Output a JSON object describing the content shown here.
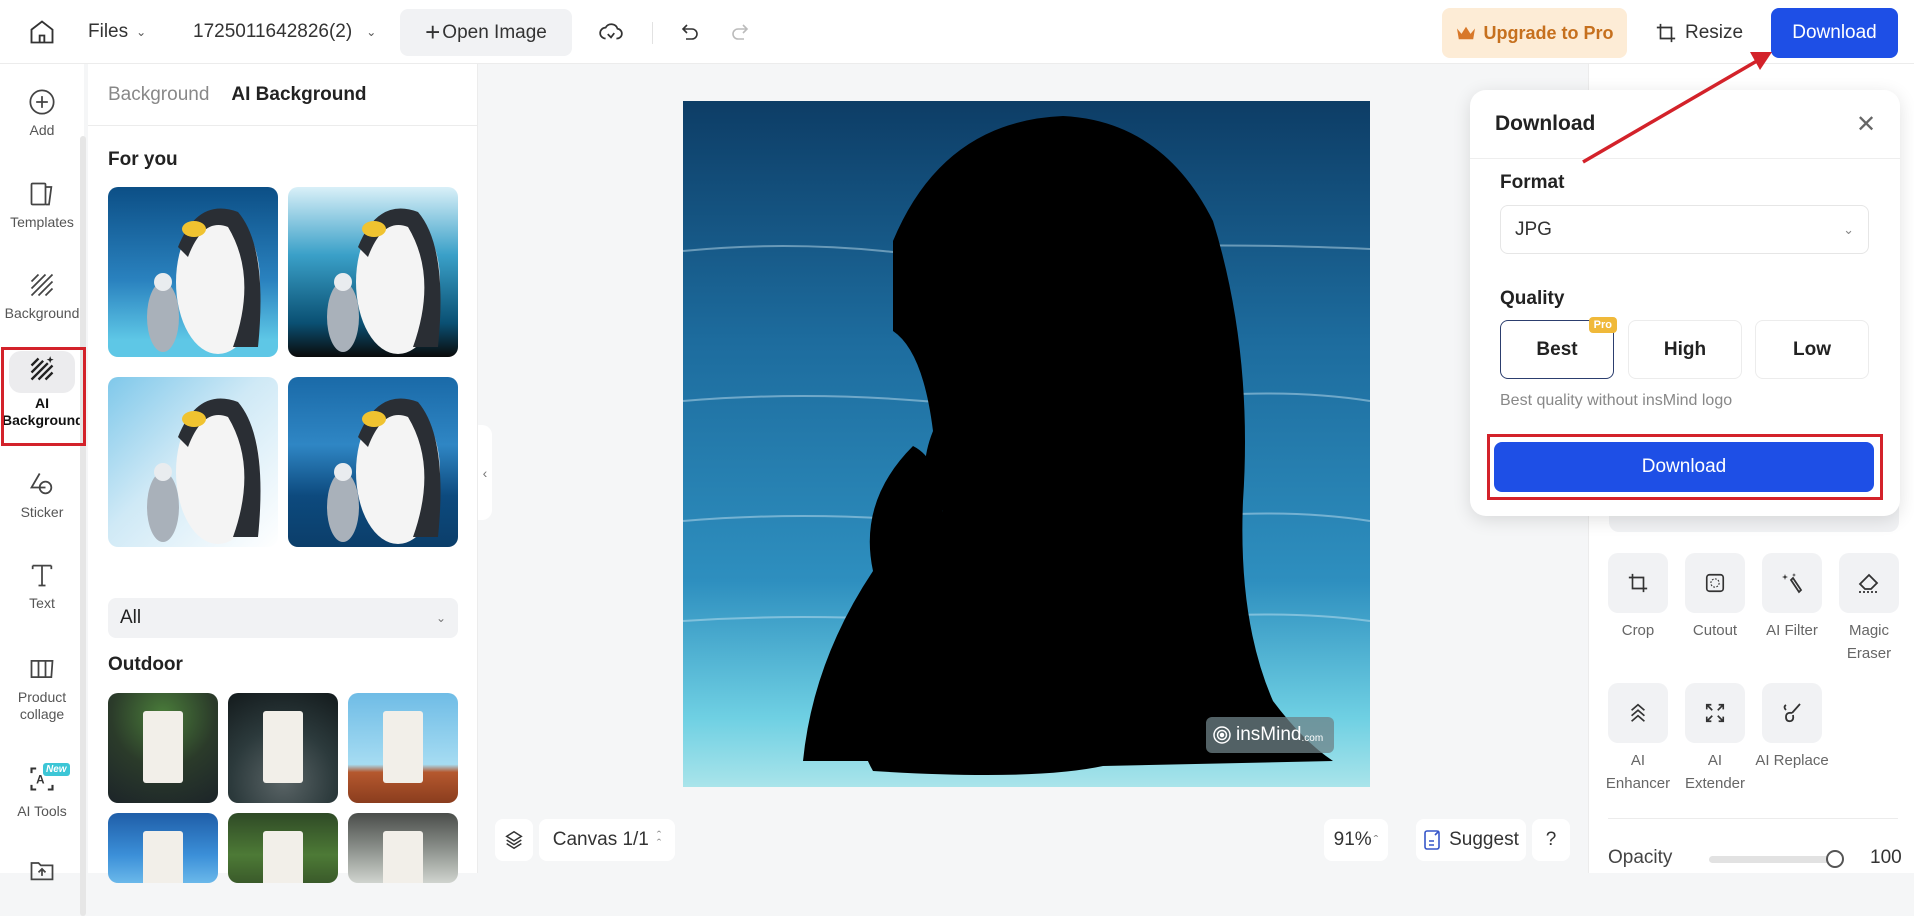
{
  "topbar": {
    "files_label": "Files",
    "filename": "1725011642826(2)",
    "open_image_label": "Open Image",
    "upgrade_label": "Upgrade to Pro",
    "resize_label": "Resize",
    "download_label": "Download"
  },
  "rail": {
    "items": [
      {
        "label": "Add"
      },
      {
        "label": "Templates"
      },
      {
        "label": "Background"
      },
      {
        "label": "AI Background"
      },
      {
        "label": "Sticker"
      },
      {
        "label": "Text"
      },
      {
        "label": "Product collage"
      },
      {
        "label": "AI Tools",
        "badge": "New"
      }
    ]
  },
  "panel": {
    "tabs": [
      {
        "label": "Background",
        "active": false
      },
      {
        "label": "AI Background",
        "active": true
      }
    ],
    "for_you_title": "For you",
    "category_select": "All",
    "outdoor_title": "Outdoor"
  },
  "canvas": {
    "watermark": "insMind",
    "watermark_suffix": ".com",
    "canvas_label": "Canvas 1/1",
    "zoom": "91%",
    "suggest_label": "Suggest",
    "help_label": "?"
  },
  "popup": {
    "title": "Download",
    "format_label": "Format",
    "format_value": "JPG",
    "quality_label": "Quality",
    "quality_options": [
      {
        "label": "Best",
        "selected": true,
        "badge": "Pro"
      },
      {
        "label": "High",
        "selected": false
      },
      {
        "label": "Low",
        "selected": false
      }
    ],
    "quality_hint": "Best quality without insMind logo",
    "download_label": "Download"
  },
  "tools": [
    {
      "label": "Crop"
    },
    {
      "label": "Cutout"
    },
    {
      "label": "AI Filter"
    },
    {
      "label": "Magic Eraser"
    },
    {
      "label": "AI Enhancer"
    },
    {
      "label": "AI Extender"
    },
    {
      "label": "AI Replace"
    }
  ],
  "opacity": {
    "label": "Opacity",
    "value": "100",
    "fraction": 1.0
  },
  "colors": {
    "accent": "#1e4fe6",
    "upgrade_bg": "#fdecd6",
    "upgrade_text": "#c6701e",
    "highlight": "#d3222a",
    "pro_badge": "#f0b93a"
  }
}
